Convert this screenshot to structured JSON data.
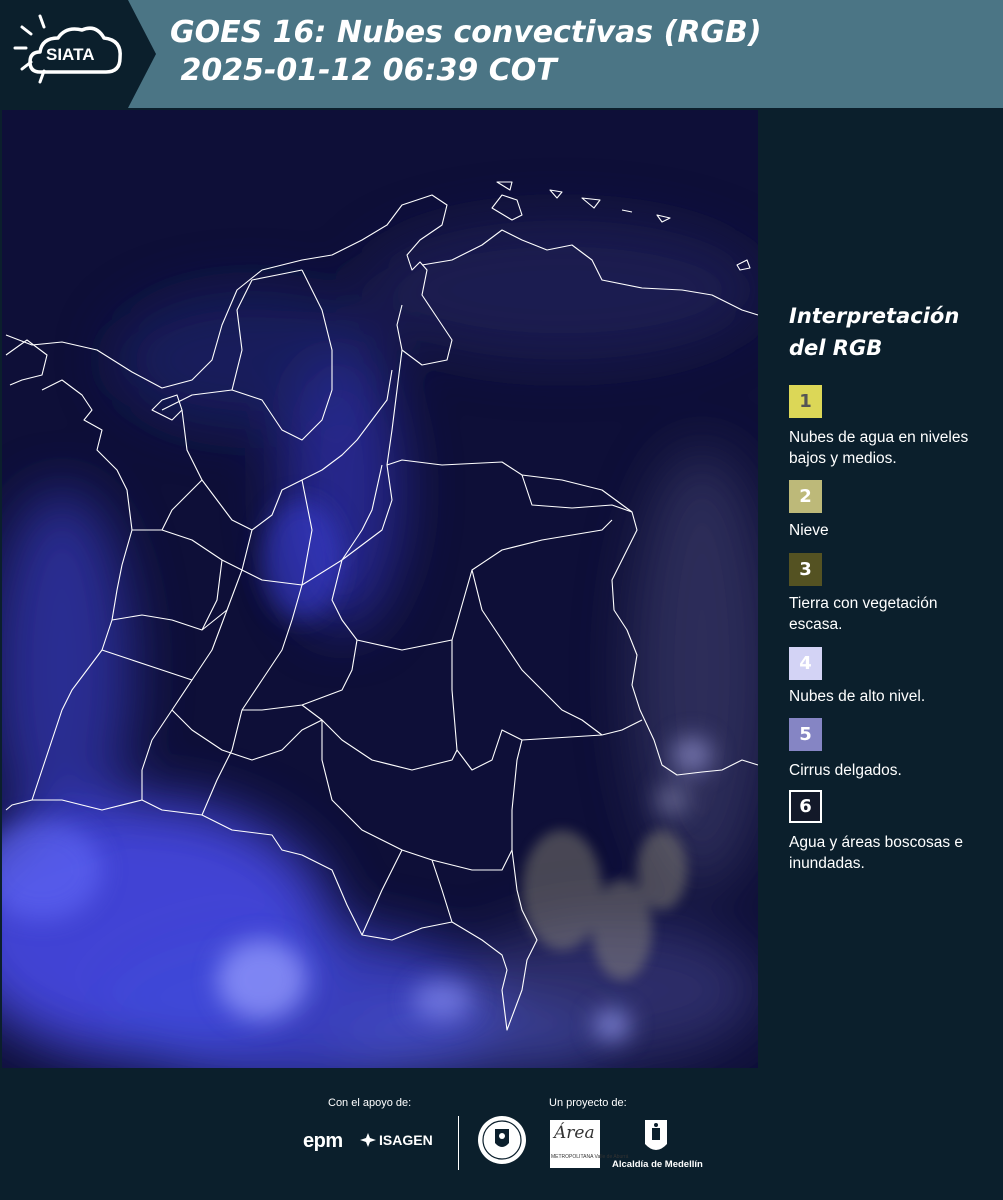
{
  "header": {
    "logo_text": "SIATA",
    "title": "GOES 16: Nubes convectivas (RGB)\n 2025-01-12 06:39 COT"
  },
  "legend": {
    "title": "Interpretación del RGB",
    "items": [
      {
        "number": "1",
        "label": "Nubes de agua en niveles bajos y medios.",
        "color": "#dcd757",
        "text_color": "#555555"
      },
      {
        "number": "2",
        "label": "Nieve",
        "color": "#bdb979",
        "text_color": "#ffffff"
      },
      {
        "number": "3",
        "label": "Tierra con vegetación escasa.",
        "color": "#545222",
        "text_color": "#ffffff"
      },
      {
        "number": "4",
        "label": "Nubes de alto nivel.",
        "color": "#d3d3f5",
        "text_color": "#ffffff"
      },
      {
        "number": "5",
        "label": "Cirrus delgados.",
        "color": "#8585c4",
        "text_color": "#ffffff"
      },
      {
        "number": "6",
        "label": "Agua y áreas boscosas e inundadas.",
        "color": "#131929",
        "text_color": "#ffffff"
      }
    ]
  },
  "footer": {
    "support_label": "Con el apoyo de:",
    "project_label": "Un proyecto de:",
    "sponsors": [
      "epm",
      "ISAGEN"
    ],
    "area_logo_text": "Área",
    "area_logo_sub": "METROPOLITANA Valle de Aburrá",
    "alcaldia": "Alcaldía de Medellín"
  },
  "colors": {
    "header_bg": "#4b7585",
    "logo_bg": "#0b1f2c",
    "page_bg": "#0b1f2c",
    "map_bg": "#0e0f38",
    "cloud_blue": "#4a4ef0",
    "boundary_line": "#ffffff"
  }
}
